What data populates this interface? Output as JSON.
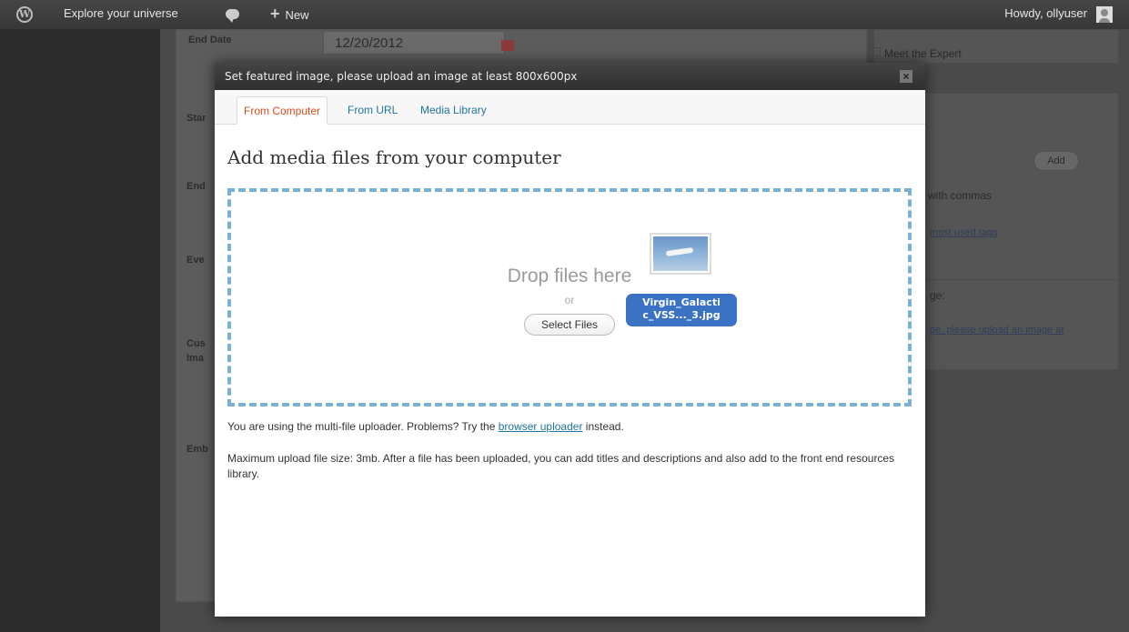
{
  "adminbar": {
    "logo_glyph": "W",
    "site_name": "Explore your universe",
    "new_label": "New",
    "howdy": "Howdy, ollyuser"
  },
  "background": {
    "end_date_label": "End Date",
    "end_date_value": "12/20/2012",
    "partial_labels": [
      "Star",
      "End",
      "Eve",
      "Cus",
      "Ima",
      "Emb"
    ],
    "meet_expert": "Meet the Expert",
    "add_button": "Add",
    "with_commas": "with commas",
    "most_used_tags": "most used tags",
    "image_heading_fragment": "ge:",
    "featured_link_fragment": "ge, please upload an image at"
  },
  "modal": {
    "title": "Set featured image, please upload an image at least 800x600px",
    "close_glyph": "×",
    "tabs": [
      {
        "label": "From Computer",
        "active": true
      },
      {
        "label": "From URL",
        "active": false
      },
      {
        "label": "Media Library",
        "active": false
      }
    ],
    "heading": "Add media files from your computer",
    "drop_text": "Drop files here",
    "or_text": "or",
    "select_button": "Select Files",
    "file_chip_line1": "Virgin_Galacti",
    "file_chip_line2": "c_VSS..._3.jpg",
    "info_prefix": "You are using the multi-file uploader. Problems? Try the ",
    "info_link": "browser uploader",
    "info_suffix": " instead.",
    "max_size_text": "Maximum upload file size: 3mb. After a file has been uploaded, you can add titles and descriptions and also add to the front end resources library."
  },
  "colors": {
    "active_tab": "#d54e21",
    "link": "#21759b",
    "dropzone_border": "#7ab0d4",
    "file_chip": "#3b72c4"
  },
  "icons": [
    "wordpress-logo-icon",
    "comment-bubble-icon",
    "plus-icon",
    "avatar-icon",
    "close-icon",
    "calendar-icon"
  ]
}
